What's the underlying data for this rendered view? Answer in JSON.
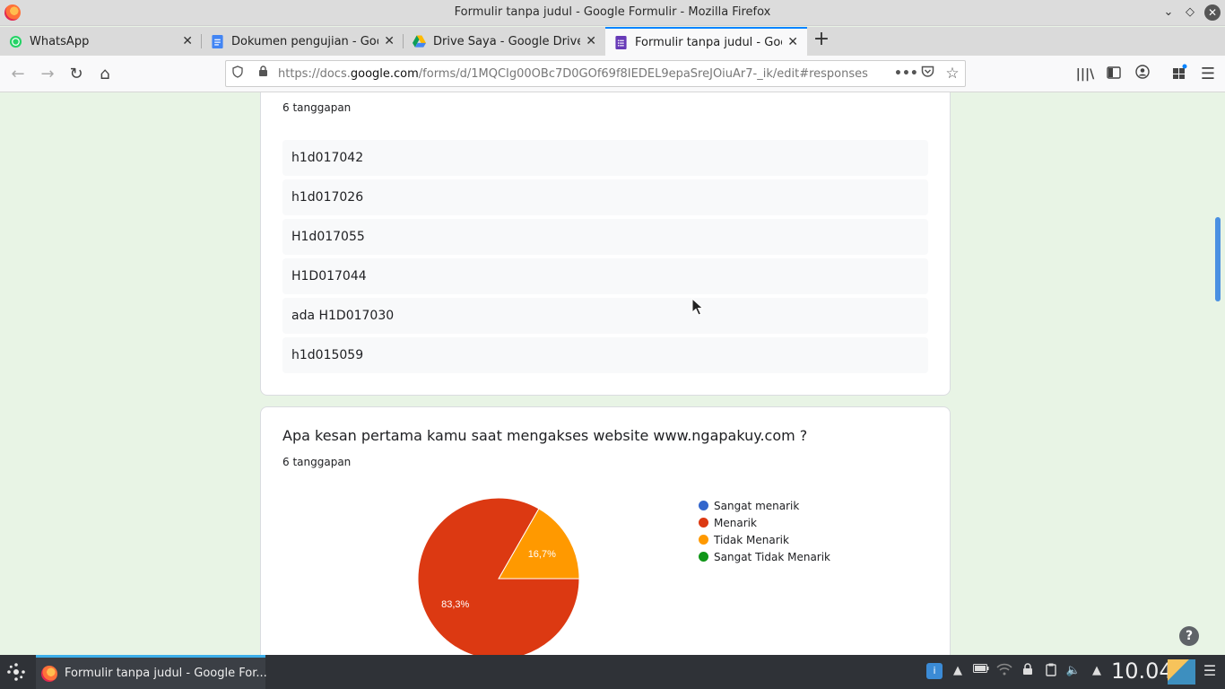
{
  "window": {
    "title": "Formulir tanpa judul - Google Formulir - Mozilla Firefox"
  },
  "tabs": [
    {
      "label": "WhatsApp",
      "icon": "whatsapp-icon"
    },
    {
      "label": "Dokumen pengujian - Goo",
      "icon": "google-docs-icon"
    },
    {
      "label": "Drive Saya - Google Drive",
      "icon": "google-drive-icon"
    },
    {
      "label": "Formulir tanpa judul - Goo",
      "icon": "google-forms-icon",
      "active": true
    }
  ],
  "navbar": {
    "url_prefix": "https://docs.",
    "url_domain": "google.com",
    "url_rest": "/forms/d/1MQCIg00OBc7D0GOf69f8IEDEL9epaSreJOiuAr7-_ik/edit#responses"
  },
  "question1": {
    "count": "6 tanggapan",
    "responses": [
      "h1d017042",
      "h1d017026",
      "H1d017055",
      "H1D017044",
      "ada H1D017030",
      "h1d015059"
    ]
  },
  "question2": {
    "title": "Apa kesan pertama kamu saat mengakses website www.ngapakuy.com ?",
    "count": "6 tanggapan",
    "legend": [
      {
        "label": "Sangat menarik",
        "color": "#3366cc"
      },
      {
        "label": "Menarik",
        "color": "#dc3912"
      },
      {
        "label": "Tidak Menarik",
        "color": "#ff9900"
      },
      {
        "label": "Sangat Tidak Menarik",
        "color": "#109618"
      }
    ],
    "slices": [
      {
        "label": "Menarik",
        "percent": 83.3,
        "text": "83,3%",
        "color": "#dc3912"
      },
      {
        "label": "Tidak Menarik",
        "percent": 16.7,
        "text": "16,7%",
        "color": "#ff9900"
      }
    ]
  },
  "taskbar": {
    "task_label": "Formulir tanpa judul - Google For...",
    "clock": "10.04"
  }
}
